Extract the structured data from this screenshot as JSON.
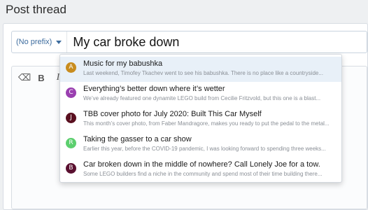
{
  "page": {
    "title": "Post thread"
  },
  "thread": {
    "prefix_label": "(No prefix)",
    "title_value": "My car broke down"
  },
  "colors": {
    "accent": "#3d6c9e",
    "active_row": "#e8f0f8"
  },
  "toolbar": {
    "buttons": [
      {
        "name": "eraser-icon",
        "glyph": "⌫"
      },
      {
        "name": "bold-button",
        "glyph": "B"
      },
      {
        "name": "italic-button",
        "glyph": "I"
      }
    ]
  },
  "suggestions": [
    {
      "avatar": "A",
      "avatar_color": "#c88c1e",
      "title": "Music for my babushka",
      "snippet": "Last weekend, Timofey Tkachev went to see his babushka. There is no place like a countryside..."
    },
    {
      "avatar": "C",
      "avatar_color": "#9a3fb0",
      "title": "Everything’s better down where it’s wetter",
      "snippet": "We’ve already featured one dynamite LEGO build from Cecilie Fritzvold, but this one is a blast..."
    },
    {
      "avatar": "J",
      "avatar_color": "#5a1020",
      "title": "TBB cover photo for July 2020: Built This Car Myself",
      "snippet": "This month’s cover photo, from Faber Mandragore, makes you ready to put the pedal to the metal..."
    },
    {
      "avatar": "R",
      "avatar_color": "#5ccf6e",
      "title": "Taking the gasser to a car show",
      "snippet": "Earlier this year, before the COVID-19 pandemic, I was looking forward to spending three weeks..."
    },
    {
      "avatar": "B",
      "avatar_color": "#5a1030",
      "title": "Car broken down in the middle of nowhere? Call Lonely Joe for a tow.",
      "snippet": "Some LEGO builders find a niche in the community and spend most of their time building there..."
    }
  ]
}
